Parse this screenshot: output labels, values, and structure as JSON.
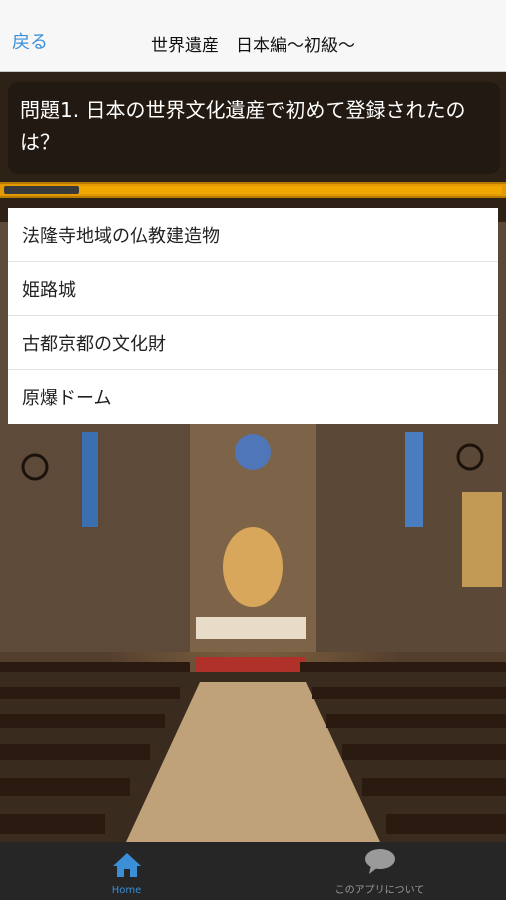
{
  "nav": {
    "back_label": "戻る",
    "title": "世界遺産　日本編〜初級〜"
  },
  "question": {
    "text": "問題1. 日本の世界文化遺産で初めて登録されたのは？"
  },
  "progress": {
    "fraction": 0.15
  },
  "answers": [
    "法隆寺地域の仏教建造物",
    "姫路城",
    "古都京都の文化財",
    "原爆ドーム"
  ],
  "tabbar": {
    "home_label": "Home",
    "about_label": "このアプリについて",
    "home_icon": "house-icon",
    "about_icon": "speech-bubble-icon",
    "active_color": "#3a8fd6",
    "inactive_color": "#9a9a9a"
  },
  "background": {
    "description_icon": "church-interior-image"
  }
}
